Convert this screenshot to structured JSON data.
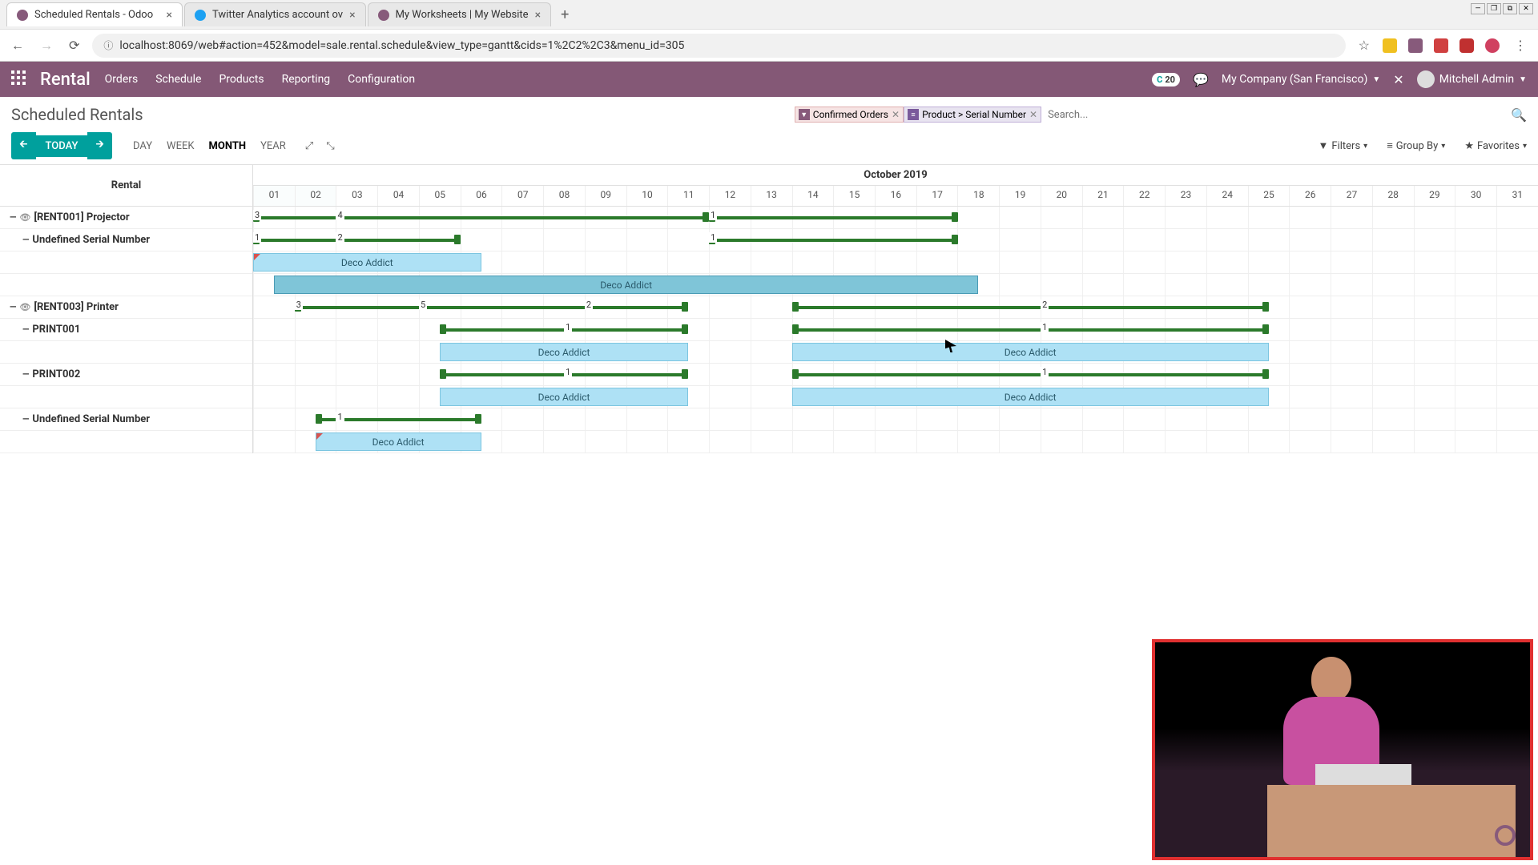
{
  "browser": {
    "tabs": [
      {
        "title": "Scheduled Rentals - Odoo",
        "favicon": "#875a7b",
        "active": true
      },
      {
        "title": "Twitter Analytics account ov",
        "favicon": "#1da1f2",
        "active": false
      },
      {
        "title": "My Worksheets | My Website",
        "favicon": "#875a7b",
        "active": false
      }
    ],
    "url": "localhost:8069/web#action=452&model=sale.rental.schedule&view_type=gantt&cids=1%2C2%2C3&menu_id=305"
  },
  "header": {
    "app": "Rental",
    "menu": [
      "Orders",
      "Schedule",
      "Products",
      "Reporting",
      "Configuration"
    ],
    "badge_count": "20",
    "company": "My Company (San Francisco)",
    "user": "Mitchell Admin"
  },
  "control": {
    "breadcrumb": "Scheduled Rentals",
    "filter_tag": "Confirmed Orders",
    "group_tag": "Product > Serial Number",
    "search_placeholder": "Search...",
    "today": "TODAY",
    "scales": [
      "DAY",
      "WEEK",
      "MONTH",
      "YEAR"
    ],
    "active_scale": "MONTH",
    "filters_label": "Filters",
    "groupby_label": "Group By",
    "favorites_label": "Favorites"
  },
  "gantt": {
    "left_header": "Rental",
    "month": "October 2019",
    "days": [
      "01",
      "02",
      "03",
      "04",
      "05",
      "06",
      "07",
      "08",
      "09",
      "10",
      "11",
      "12",
      "13",
      "14",
      "15",
      "16",
      "17",
      "18",
      "19",
      "20",
      "21",
      "22",
      "23",
      "24",
      "25",
      "26",
      "27",
      "28",
      "29",
      "30",
      "31"
    ],
    "groups": [
      {
        "name": "[RENT001] Projector",
        "eye": true,
        "consol": [
          {
            "start": 0,
            "end": 11,
            "marks": [
              {
                "at": 0,
                "n": "3"
              },
              {
                "at": 2,
                "n": "4"
              }
            ]
          },
          {
            "start": 11,
            "end": 17,
            "marks": [
              {
                "at": 11,
                "n": "1"
              }
            ]
          }
        ],
        "subs": [
          {
            "name": "Undefined Serial Number",
            "consol": [
              {
                "start": 0,
                "end": 5,
                "marks": [
                  {
                    "at": 0,
                    "n": "1"
                  },
                  {
                    "at": 2,
                    "n": "2"
                  }
                ]
              },
              {
                "start": 11,
                "end": 17,
                "marks": [
                  {
                    "at": 11,
                    "n": "1"
                  }
                ]
              }
            ],
            "pills": [
              {
                "start": 0,
                "end": 5.5,
                "label": "Deco Addict",
                "corner": true
              },
              {
                "start": 0.5,
                "end": 17.5,
                "label": "Deco Addict",
                "selected": true
              }
            ]
          }
        ]
      },
      {
        "name": "[RENT003] Printer",
        "eye": true,
        "consol": [
          {
            "start": 1,
            "end": 10.5,
            "marks": [
              {
                "at": 1,
                "n": "3"
              },
              {
                "at": 4,
                "n": "5"
              },
              {
                "at": 8,
                "n": "2"
              }
            ]
          },
          {
            "start": 13,
            "end": 24.5,
            "marks": [
              {
                "at": 19,
                "n": "2"
              }
            ]
          }
        ],
        "subs": [
          {
            "name": "PRINT001",
            "consol": [
              {
                "start": 4.5,
                "end": 10.5,
                "marks": [
                  {
                    "at": 7.5,
                    "n": "1"
                  }
                ]
              },
              {
                "start": 13,
                "end": 24.5,
                "marks": [
                  {
                    "at": 19,
                    "n": "1"
                  }
                ]
              }
            ],
            "pills": [
              {
                "start": 4.5,
                "end": 10.5,
                "label": "Deco Addict"
              },
              {
                "start": 13,
                "end": 24.5,
                "label": "Deco Addict"
              }
            ]
          },
          {
            "name": "PRINT002",
            "consol": [
              {
                "start": 4.5,
                "end": 10.5,
                "marks": [
                  {
                    "at": 7.5,
                    "n": "1"
                  }
                ]
              },
              {
                "start": 13,
                "end": 24.5,
                "marks": [
                  {
                    "at": 19,
                    "n": "1"
                  }
                ]
              }
            ],
            "pills": [
              {
                "start": 4.5,
                "end": 10.5,
                "label": "Deco Addict"
              },
              {
                "start": 13,
                "end": 24.5,
                "label": "Deco Addict"
              }
            ]
          },
          {
            "name": "Undefined Serial Number",
            "consol": [
              {
                "start": 1.5,
                "end": 5.5,
                "marks": [
                  {
                    "at": 2,
                    "n": "1"
                  }
                ]
              }
            ],
            "pills": [
              {
                "start": 1.5,
                "end": 5.5,
                "label": "Deco Addict",
                "corner": true
              }
            ]
          }
        ]
      }
    ]
  }
}
